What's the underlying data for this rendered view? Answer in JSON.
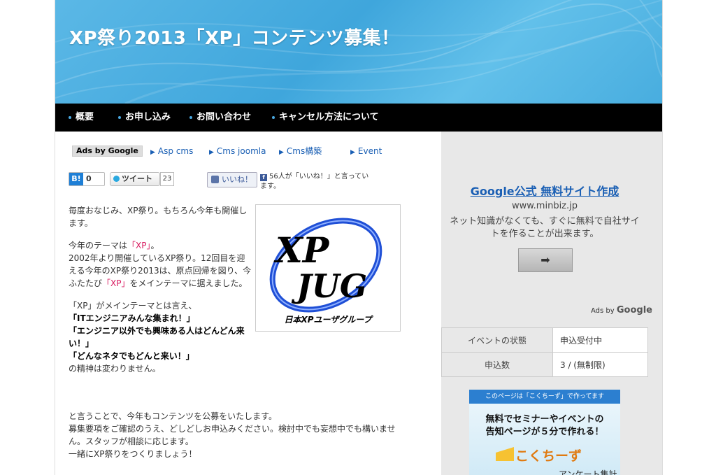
{
  "header": {
    "title": "XP祭り2013「XP」コンテンツ募集！"
  },
  "nav": {
    "items": [
      {
        "label": "概要"
      },
      {
        "label": "お申し込み"
      },
      {
        "label": "お問い合わせ"
      },
      {
        "label": "キャンセル方法について"
      }
    ]
  },
  "ads_bar": {
    "label": "Ads by Google",
    "links": [
      "Asp cms",
      "Cms joomla",
      "Cms構築",
      "Event"
    ]
  },
  "social": {
    "hatena_label": "B!",
    "hatena_count": "0",
    "tweet_label": "ツイート",
    "tweet_count": "23",
    "like_label": "いいね！",
    "like_text": "56人が「いいね！」と言っています。"
  },
  "intro": {
    "p1": "毎度おなじみ、XP祭り。もちろん今年も開催します。",
    "p2_pre": "今年のテーマは",
    "p2_hl": "「XP」",
    "p2_post": "。",
    "p3": "2002年より開催しているXP祭り。12回目を迎える今年のXP祭り2013は、原点回帰を図り、今ふたたび",
    "p3_hl": "「XP」",
    "p3_post": "をメインテーマに据えました。",
    "p4": "「XP」がメインテーマとは言え、",
    "s1": "「ITエンジニアみんな集まれ！」",
    "s2": "「エンジニア以外でも興味ある人はどんどん来い！」",
    "s3": "「どんなネタでもどんと来い！」",
    "p5": "の精神は変わりません。"
  },
  "logo": {
    "line1": "XP",
    "line2": "JUG",
    "caption": "日本XPユーザグループ"
  },
  "outro": {
    "l1": "と言うことで、今年もコンテンツを公募をいたします。",
    "l2": "募集要項をご確認のうえ、どしどしお申込みください。検討中でも妄想中でも構いません。スタッフが相談に応じます。",
    "l3": "一緒にXP祭りをつくりましょう！"
  },
  "sidebar_ad": {
    "title": "Google公式 無料サイト作成",
    "url": "www.minbiz.jp",
    "desc": "ネット知識がなくても、すぐに無料で自社サイトを作ることが出来ます。",
    "button": "➡",
    "ads_by": "Ads by",
    "ads_brand": "Google"
  },
  "event_info": {
    "rows": [
      {
        "key": "イベントの状態",
        "value": "申込受付中"
      },
      {
        "key": "申込数",
        "value": "3 / (無制限)"
      }
    ]
  },
  "banner": {
    "top": "このページは「こくちーず」で作ってます",
    "line1": "無料でセミナーやイベントの",
    "line2": "告知ページが５分で作れる！",
    "brand": "こくちーず",
    "partial": "アンケート集計"
  },
  "colors": {
    "nav_bg": "#000000",
    "header_blue": "#4aaee0",
    "link": "#1a5fb4",
    "highlight": "#d81b60"
  }
}
